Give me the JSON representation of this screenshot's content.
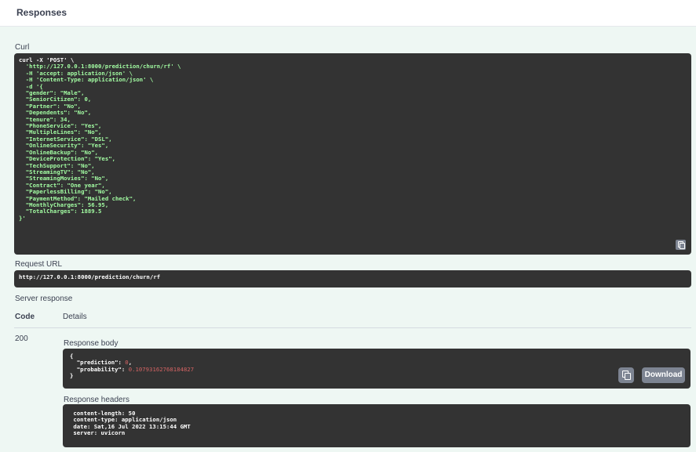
{
  "header": {
    "title": "Responses"
  },
  "curl": {
    "label": "Curl",
    "lines": [
      "curl -X 'POST' \\",
      "  'http://127.0.0.1:8000/prediction/churn/rf' \\",
      "  -H 'accept: application/json' \\",
      "  -H 'Content-Type: application/json' \\",
      "  -d '{",
      "  \"gender\": \"Male\",",
      "  \"SeniorCitizen\": 0,",
      "  \"Partner\": \"No\",",
      "  \"Dependents\": \"No\",",
      "  \"tenure\": 34,",
      "  \"PhoneService\": \"Yes\",",
      "  \"MultipleLines\": \"No\",",
      "  \"InternetService\": \"DSL\",",
      "  \"OnlineSecurity\": \"Yes\",",
      "  \"OnlineBackup\": \"No\",",
      "  \"DeviceProtection\": \"Yes\",",
      "  \"TechSupport\": \"No\",",
      "  \"StreamingTV\": \"No\",",
      "  \"StreamingMovies\": \"No\",",
      "  \"Contract\": \"One year\",",
      "  \"PaperlessBilling\": \"No\",",
      "  \"PaymentMethod\": \"Mailed check\",",
      "  \"MonthlyCharges\": 56.95,",
      "  \"TotalCharges\": 1889.5",
      "}'"
    ]
  },
  "request_url": {
    "label": "Request URL",
    "value": "http://127.0.0.1:8000/prediction/churn/rf"
  },
  "server_response": {
    "label": "Server response",
    "col_code": "Code",
    "col_details": "Details",
    "code": "200",
    "body_label": "Response body",
    "body": {
      "open": "{",
      "prediction_key": "  \"prediction\": ",
      "prediction_val": "0",
      "probability_key": "  \"probability\": ",
      "probability_val": "0.10793162768184827",
      "close": "}"
    },
    "download_label": "Download",
    "headers_label": "Response headers",
    "headers": [
      " content-length: 50 ",
      " content-type: application/json ",
      " date: Sat,16 Jul 2022 13:15:44 GMT ",
      " server: uvicorn "
    ]
  },
  "colors": {
    "code_bg": "#333333",
    "code_string": "#a2fca2",
    "code_number": "#d36363",
    "panel_bg": "#eef7f3",
    "button_gray": "#7d8492"
  }
}
